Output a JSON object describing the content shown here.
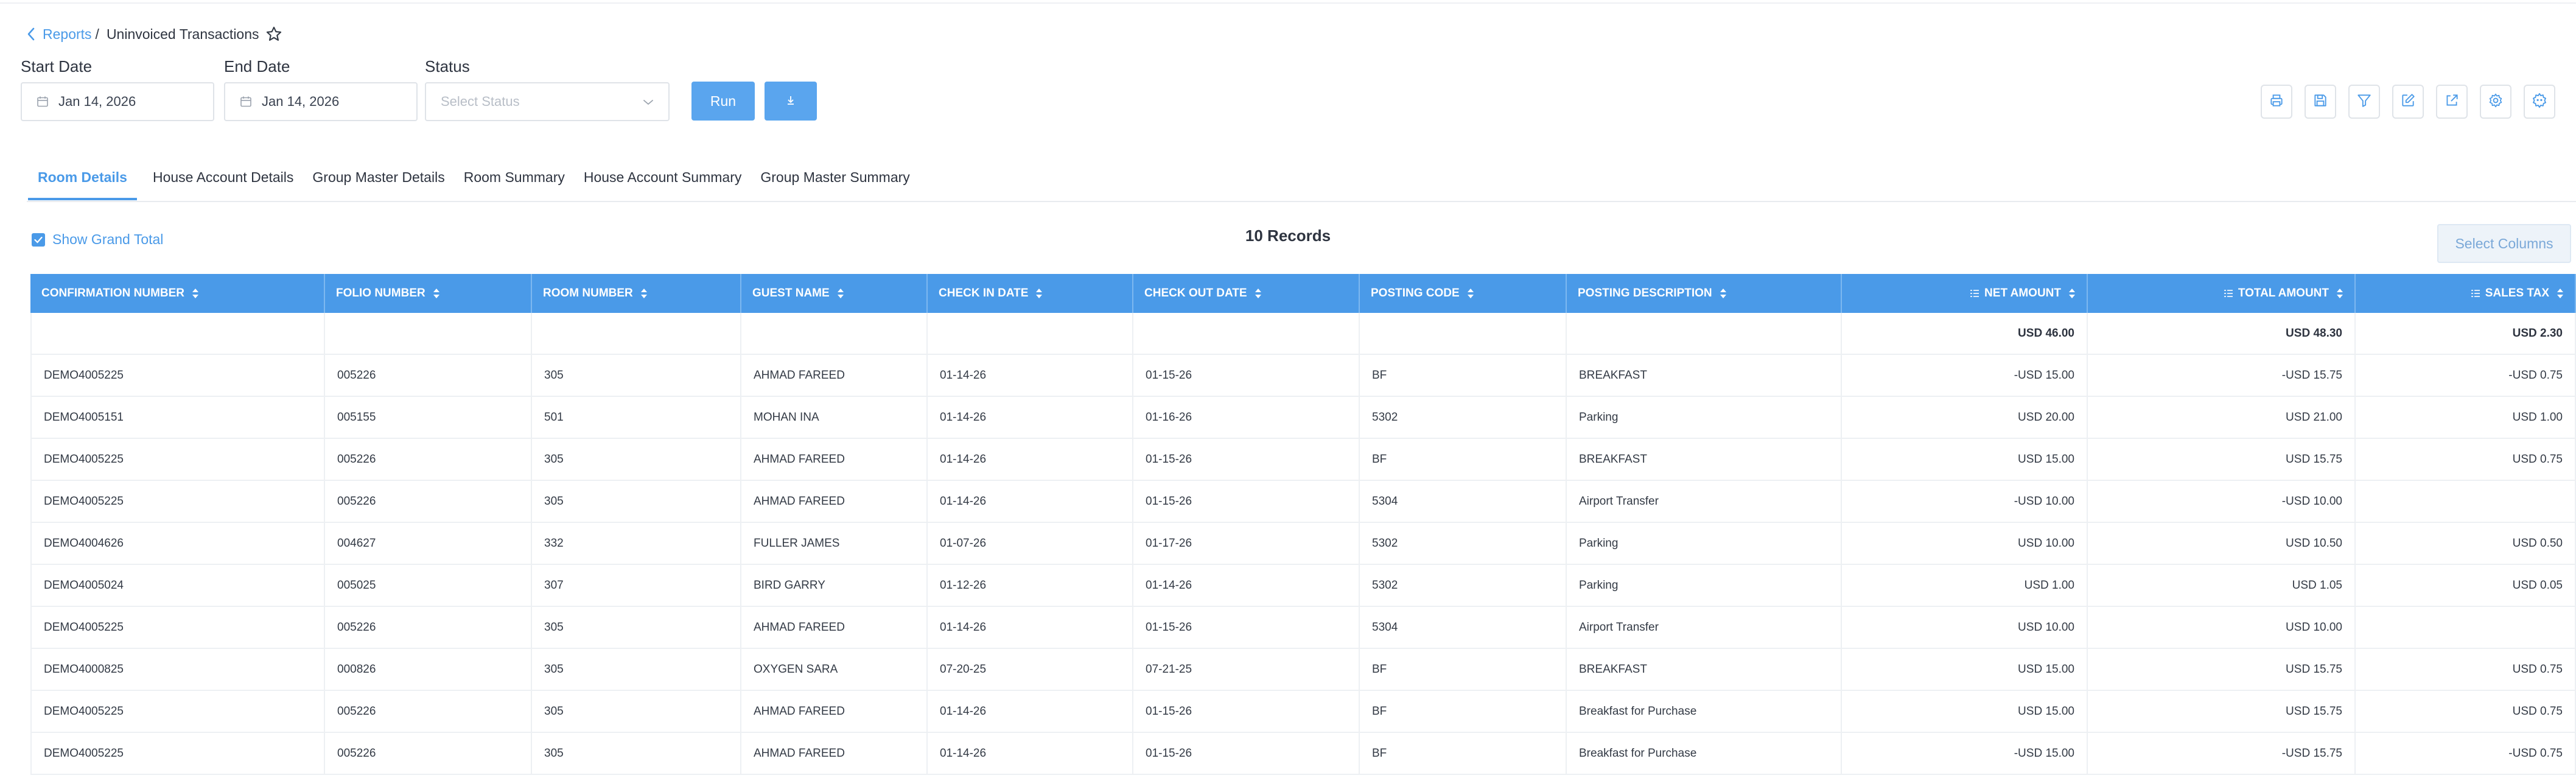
{
  "breadcrumb": {
    "parent": "Reports",
    "separator": "/",
    "current": "Uninvoiced Transactions"
  },
  "filters": {
    "start_date_label": "Start Date",
    "start_date_value": "Jan 14, 2026",
    "end_date_label": "End Date",
    "end_date_value": "Jan 14, 2026",
    "status_label": "Status",
    "status_placeholder": "Select Status",
    "run_label": "Run"
  },
  "toolbar_icons": [
    "print-icon",
    "save-icon",
    "filter-icon",
    "edit-icon",
    "export-icon",
    "settings-icon",
    "advanced-settings-icon"
  ],
  "tabs": [
    "Room Details",
    "House Account Details",
    "Group Master Details",
    "Room Summary",
    "House Account Summary",
    "Group Master Summary"
  ],
  "active_tab": "Room Details",
  "show_grand_total_label": "Show Grand Total",
  "records_label": "10 Records",
  "select_columns_label": "Select Columns",
  "colors": {
    "accent": "#4a9ae8",
    "button": "#5aa5ee",
    "header_text": "#ffffff"
  },
  "table": {
    "columns": [
      "CONFIRMATION NUMBER",
      "FOLIO NUMBER",
      "ROOM NUMBER",
      "GUEST NAME",
      "CHECK IN DATE",
      "CHECK OUT DATE",
      "POSTING CODE",
      "POSTING DESCRIPTION",
      "NET AMOUNT",
      "TOTAL AMOUNT",
      "SALES TAX"
    ],
    "totals": [
      "",
      "",
      "",
      "",
      "",
      "",
      "",
      "",
      "USD 46.00",
      "USD 48.30",
      "USD 2.30"
    ],
    "rows": [
      [
        "DEMO4005225",
        "005226",
        "305",
        "AHMAD FAREED",
        "01-14-26",
        "01-15-26",
        "BF",
        "BREAKFAST",
        "-USD 15.00",
        "-USD 15.75",
        "-USD 0.75"
      ],
      [
        "DEMO4005151",
        "005155",
        "501",
        "MOHAN INA",
        "01-14-26",
        "01-16-26",
        "5302",
        "Parking",
        "USD 20.00",
        "USD 21.00",
        "USD 1.00"
      ],
      [
        "DEMO4005225",
        "005226",
        "305",
        "AHMAD FAREED",
        "01-14-26",
        "01-15-26",
        "BF",
        "BREAKFAST",
        "USD 15.00",
        "USD 15.75",
        "USD 0.75"
      ],
      [
        "DEMO4005225",
        "005226",
        "305",
        "AHMAD FAREED",
        "01-14-26",
        "01-15-26",
        "5304",
        "Airport Transfer",
        "-USD 10.00",
        "-USD 10.00",
        ""
      ],
      [
        "DEMO4004626",
        "004627",
        "332",
        "FULLER JAMES",
        "01-07-26",
        "01-17-26",
        "5302",
        "Parking",
        "USD 10.00",
        "USD 10.50",
        "USD 0.50"
      ],
      [
        "DEMO4005024",
        "005025",
        "307",
        "BIRD GARRY",
        "01-12-26",
        "01-14-26",
        "5302",
        "Parking",
        "USD 1.00",
        "USD 1.05",
        "USD 0.05"
      ],
      [
        "DEMO4005225",
        "005226",
        "305",
        "AHMAD FAREED",
        "01-14-26",
        "01-15-26",
        "5304",
        "Airport Transfer",
        "USD 10.00",
        "USD 10.00",
        ""
      ],
      [
        "DEMO4000825",
        "000826",
        "305",
        "OXYGEN SARA",
        "07-20-25",
        "07-21-25",
        "BF",
        "BREAKFAST",
        "USD 15.00",
        "USD 15.75",
        "USD 0.75"
      ],
      [
        "DEMO4005225",
        "005226",
        "305",
        "AHMAD FAREED",
        "01-14-26",
        "01-15-26",
        "BF",
        "Breakfast for Purchase",
        "USD 15.00",
        "USD 15.75",
        "USD 0.75"
      ],
      [
        "DEMO4005225",
        "005226",
        "305",
        "AHMAD FAREED",
        "01-14-26",
        "01-15-26",
        "BF",
        "Breakfast for Purchase",
        "-USD 15.00",
        "-USD 15.75",
        "-USD 0.75"
      ]
    ]
  }
}
